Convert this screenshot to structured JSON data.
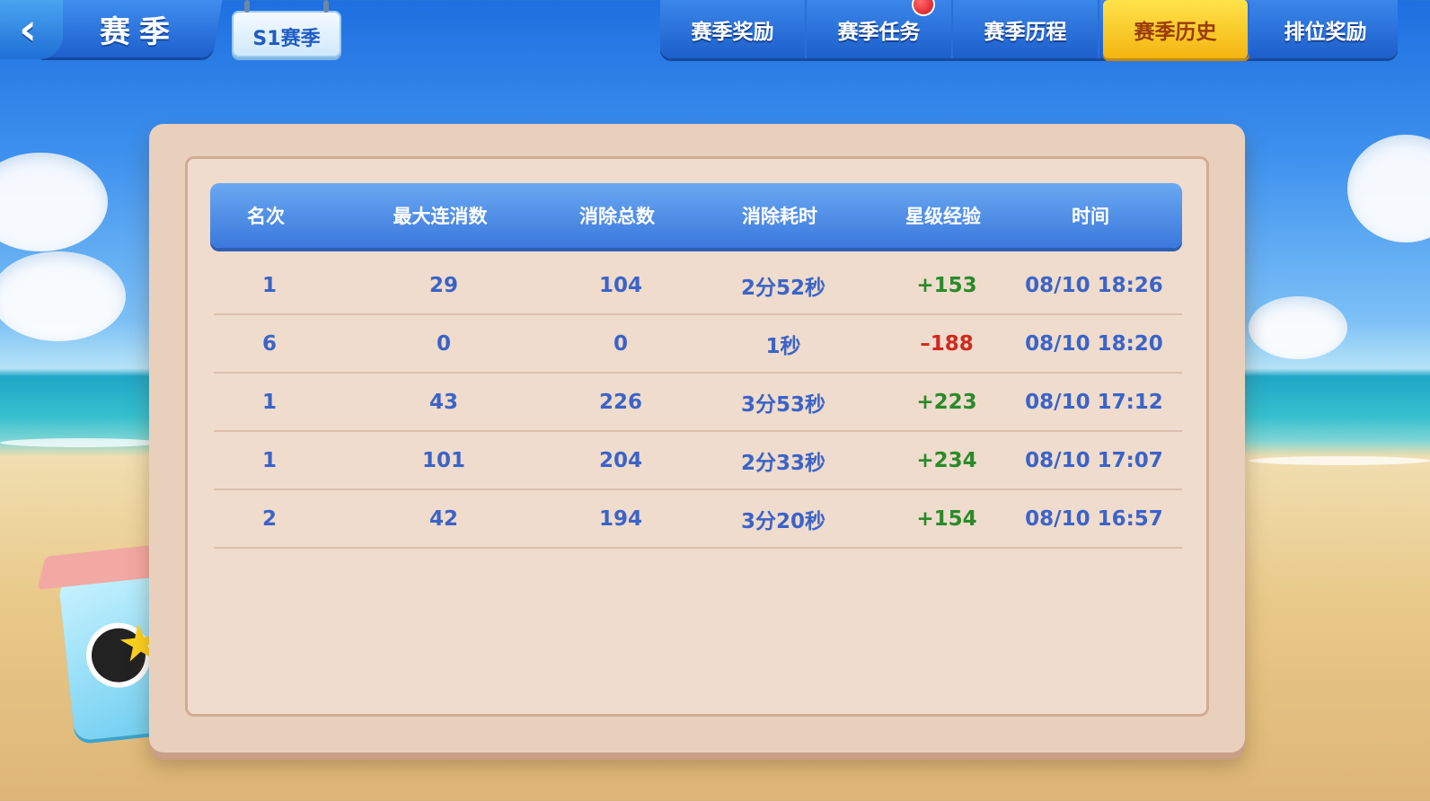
{
  "header": {
    "title": "赛季",
    "season_tag": "S1赛季",
    "tabs": [
      {
        "label": "赛季奖励",
        "active": false,
        "badge": false
      },
      {
        "label": "赛季任务",
        "active": false,
        "badge": true
      },
      {
        "label": "赛季历程",
        "active": false,
        "badge": false
      },
      {
        "label": "赛季历史",
        "active": true,
        "badge": false
      },
      {
        "label": "排位奖励",
        "active": false,
        "badge": false
      }
    ]
  },
  "history_table": {
    "columns": [
      "名次",
      "最大连消数",
      "消除总数",
      "消除耗时",
      "星级经验",
      "时间"
    ],
    "rows": [
      {
        "rank": "1",
        "max_combo": "29",
        "total_cleared": "104",
        "duration": "2分52秒",
        "star_exp": "+153",
        "time": "08/10 18:26"
      },
      {
        "rank": "6",
        "max_combo": "0",
        "total_cleared": "0",
        "duration": "1秒",
        "star_exp": "–188",
        "time": "08/10 18:20"
      },
      {
        "rank": "1",
        "max_combo": "43",
        "total_cleared": "226",
        "duration": "3分53秒",
        "star_exp": "+223",
        "time": "08/10 17:12"
      },
      {
        "rank": "1",
        "max_combo": "101",
        "total_cleared": "204",
        "duration": "2分33秒",
        "star_exp": "+234",
        "time": "08/10 17:07"
      },
      {
        "rank": "2",
        "max_combo": "42",
        "total_cleared": "194",
        "duration": "3分20秒",
        "star_exp": "+154",
        "time": "08/10 16:57"
      }
    ]
  },
  "icons": {
    "back": "chevron-left-icon",
    "notification": "red-dot-badge",
    "mascot": "cube-mascot-character"
  },
  "colors": {
    "header_blue": "#3a78dc",
    "active_tab_yellow": "#f4b511",
    "value_blue": "#3b63c9",
    "gain_green": "#2a8a2a",
    "loss_red": "#d0281e"
  }
}
